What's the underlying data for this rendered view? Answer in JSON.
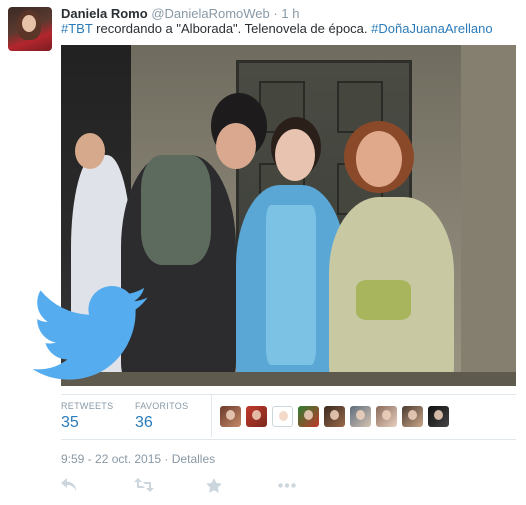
{
  "tweet": {
    "author_name": "Daniela Romo",
    "author_handle": "@DanielaRomoWeb",
    "separator": "·",
    "time_ago": "1 h",
    "text_tag1": "#TBT",
    "text_body": " recordando a \"Alborada\". Telenovela de época. ",
    "text_tag2": "#DoñaJuanaArellano"
  },
  "stats": {
    "retweets_label": "RETWEETS",
    "retweets_count": "35",
    "favorites_label": "FAVORITOS",
    "favorites_count": "36"
  },
  "meta": {
    "timestamp": "9:59 - 22 oct. 2015",
    "separator": "·",
    "details_label": "Detalles"
  },
  "actions": {
    "reply_icon": "reply-icon",
    "retweet_icon": "retweet-icon",
    "favorite_icon": "star-icon",
    "more_icon": "more-icon"
  },
  "colors": {
    "link": "#2b7bb9",
    "muted": "#8899a6",
    "twitter_blue": "#55acee",
    "divider": "#e1e8ed"
  }
}
